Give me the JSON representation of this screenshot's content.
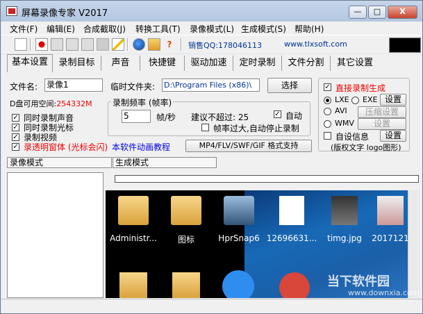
{
  "window": {
    "title": "屏幕录像专家 V2017",
    "min_label": "—",
    "max_label": "□",
    "close_label": "X"
  },
  "menu": [
    "文件(F)",
    "编辑(E)",
    "合成截取(J)",
    "转换工具(T)",
    "录像模式(L)",
    "生成模式(S)",
    "帮助(H)"
  ],
  "toolbar": {
    "qq_label": "销售QQ:178046113",
    "website": "www.tlxsoft.com"
  },
  "tabs": [
    "基本设置",
    "录制目标",
    "声音",
    "快捷键",
    "驱动加速",
    "定时录制",
    "文件分割",
    "其它设置"
  ],
  "basic": {
    "filename_label": "文件名:",
    "filename_value": "录像1",
    "temp_folder_label": "临时文件夹:",
    "temp_folder_value": "D:\\Program Files (x86)\\",
    "choose_button": "选择",
    "disk_space_label": "D盘可用空间:",
    "disk_space_value": "254332M",
    "rate_group_title": "录制频率 (帧率)",
    "fps_value": "5",
    "fps_unit": "帧/秒",
    "max_suggest_label": "建议不超过:",
    "max_suggest_value": "25",
    "auto_label": "自动",
    "auto_stop_label": "帧率过大,自动停止录制",
    "options": [
      {
        "label": "同时录制声音",
        "checked": true
      },
      {
        "label": "同时录制光标",
        "checked": true
      },
      {
        "label": "录制视频",
        "checked": true
      },
      {
        "label": "录透明窗体 (光标会闪)",
        "checked": true
      }
    ],
    "tutorial_link": "本软件动画教程",
    "format_button": "MP4/FLV/SWF/GIF 格式支持"
  },
  "direct": {
    "direct_label": "直接录制生成",
    "lxe_label": "LXE",
    "exe_label": "EXE",
    "avi_label": "AVI",
    "wmv_label": "WMV",
    "settings_button": "设置",
    "compress_button": "压缩设置",
    "settings_button2": "设置",
    "custom_info_label": "自设信息",
    "settings_button3": "设置",
    "note": "(版权文字 logo图形)"
  },
  "lower": {
    "record_mode_tab": "录像模式",
    "generate_mode_tab": "生成模式"
  },
  "desktop_icons": [
    {
      "name": "Administr..."
    },
    {
      "name": "图标"
    },
    {
      "name": "HprSnap6"
    },
    {
      "name": "12696631..."
    },
    {
      "name": "timg.jpg"
    },
    {
      "name": "2017121"
    }
  ],
  "watermark": {
    "brand": "当下软件园",
    "url": "www.downxia.com"
  },
  "colors": {
    "accent": "#003399",
    "red": "#e00000",
    "link": "#0000dd"
  }
}
